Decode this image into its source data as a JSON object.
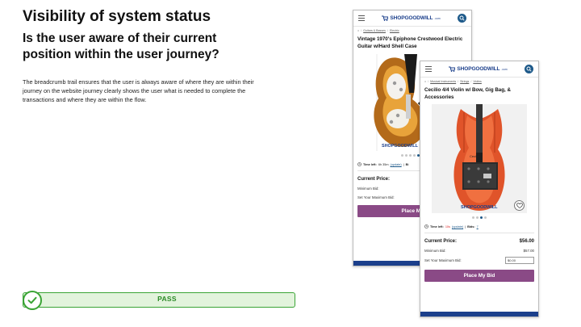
{
  "slide": {
    "title": "Visibility of system status",
    "question": "Is the user aware of their current position within the user journey?",
    "body": "The breadcrumb trail ensures that the user is always aware of where they are within their journey on the website journey clearly shows the user what is needed to complete the transactions and where they are within the flow.",
    "verdict": "PASS",
    "colors": {
      "pass_green": "#3aa435",
      "pass_fill": "#e2f3dc",
      "brand_blue": "#1b3f8b",
      "bid_purple": "#8a4a86"
    }
  },
  "phone_back": {
    "logo_text": "SHOPGOODWILL",
    "logo_suffix": ".com",
    "breadcrumb": [
      "Guitars & Basses",
      "Electric"
    ],
    "title": "Vintage 1970's Epiphone Crestwood Electric Guitar w/Hard Shell Case",
    "watermark": "SHOPGOODWILL",
    "time_left_label": "Time left:",
    "time_left_value": "6h 35m",
    "update_link": "(update)",
    "bids_label": "Bi",
    "current_price_label": "Current Price:",
    "minimum_bid_label": "Minimum Bid:",
    "max_bid_label": "Set Your Maximum Bid:",
    "bid_button": "Place My"
  },
  "phone_front": {
    "logo_text": "SHOPGOODWILL",
    "logo_suffix": ".com",
    "breadcrumb": [
      "Musical Instruments",
      "Strings",
      "Violins"
    ],
    "title": "Cecilio 4/4 Violin w/ Bow, Gig Bag, & Accessories",
    "watermark": "SHOPGOODWILL",
    "time_left_label": "Time left:",
    "time_left_value": "10s",
    "update_link": "(update)",
    "bids_label": "Bids:",
    "bids_value": "7",
    "current_price_label": "Current Price:",
    "current_price_value": "$56.00",
    "minimum_bid_label": "Minimum Bid:",
    "minimum_bid_value": "$57.00",
    "max_bid_label": "Set Your Maximum Bid:",
    "max_bid_placeholder": "$0.00",
    "bid_button": "Place My Bid"
  }
}
